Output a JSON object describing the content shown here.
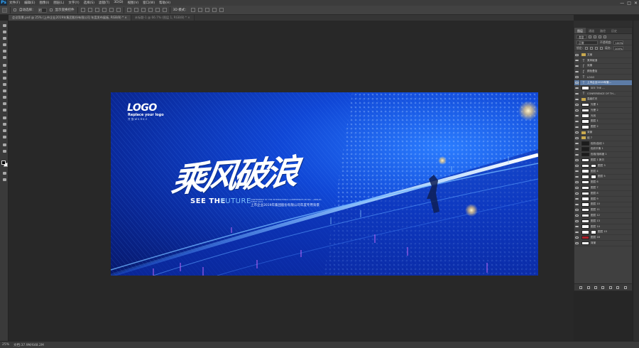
{
  "app": {
    "logo": "Ps",
    "window_controls": [
      "—",
      "□",
      "✕"
    ]
  },
  "menu": [
    "文件(F)",
    "编辑(E)",
    "图像(I)",
    "图层(L)",
    "文字(Y)",
    "选择(S)",
    "滤镜(T)",
    "3D(D)",
    "视图(V)",
    "窗口(W)",
    "帮助(H)"
  ],
  "options": {
    "auto_select_label": "自动选择：",
    "auto_select_value": "组",
    "show_transform_label": "显示变换控件",
    "mode_3d_label": "3D 模式："
  },
  "tabs": [
    {
      "label": "会议背景.psd @ 25% (上市企业2019年集团股份有限公司 年度发布展板, RGB/8) * ×"
    },
    {
      "label": "未标题-1 @ 66.7% (图层 1, RGB/8) * ×"
    }
  ],
  "artwork": {
    "logo": "LOGO",
    "logo_sub": "Replace your logo",
    "logo_sub2": "开 放  W S R K 2",
    "headline": "乘风破浪",
    "see": "SEE THE",
    "future": "FUTURE",
    "conference_en": "CONFERENCE OF THE INTERNATIONAL CONFERENCE ON HIG... ANNUAL EVENT 2019",
    "conference_cn": "上市企业2019年集团股份有限公司年度专用背景"
  },
  "status": {
    "zoom": "25%",
    "doc": "文档:37.9M/648.2M"
  },
  "panel": {
    "tabs": [
      "图层",
      "通道",
      "路径",
      "历史"
    ],
    "filter_label": "类型",
    "blend_mode": "正常",
    "opacity_label": "不透明度:",
    "opacity_value": "100%",
    "lock_label": "锁定:",
    "fill_label": "填充:",
    "fill_value": "100%"
  },
  "layers": [
    {
      "name": "文案",
      "kind": "folder"
    },
    {
      "name": "乘风破浪",
      "kind": "text"
    },
    {
      "name": "效果",
      "kind": "fx"
    },
    {
      "name": "颜色叠加",
      "kind": "fx"
    },
    {
      "name": "LOGO",
      "kind": "text"
    },
    {
      "name": "上市企业2019年集...",
      "kind": "text",
      "selected": true
    },
    {
      "name": "SEE THE ...",
      "kind": "pixel"
    },
    {
      "name": "CONFERENCE OF TH...",
      "kind": "text"
    },
    {
      "name": "高级灯光",
      "kind": "folder"
    },
    {
      "name": "光晕 1",
      "kind": "pixel"
    },
    {
      "name": "光晕 2",
      "kind": "pixel"
    },
    {
      "name": "光效",
      "kind": "pixel"
    },
    {
      "name": "图层 1",
      "kind": "pixel"
    },
    {
      "name": "图层 2",
      "kind": "pixel"
    },
    {
      "name": "背景",
      "kind": "folder"
    },
    {
      "name": "组 7",
      "kind": "folder"
    },
    {
      "name": "色阶/曲线 1",
      "kind": "adjust"
    },
    {
      "name": "色彩平衡 1",
      "kind": "adjust"
    },
    {
      "name": "色相/饱和度 1",
      "kind": "adjust"
    },
    {
      "name": "图层 1 拷贝",
      "kind": "pixel"
    },
    {
      "name": "图层 3",
      "kind": "mask"
    },
    {
      "name": "图层 4",
      "kind": "pixel"
    },
    {
      "name": "图层 5",
      "kind": "mask"
    },
    {
      "name": "图层 6",
      "kind": "pixel"
    },
    {
      "name": "图层 7",
      "kind": "pixel"
    },
    {
      "name": "图层 8",
      "kind": "pixel"
    },
    {
      "name": "图层 9",
      "kind": "pixel"
    },
    {
      "name": "图层 10",
      "kind": "pixel"
    },
    {
      "name": "图层 11",
      "kind": "pixel"
    },
    {
      "name": "图层 12",
      "kind": "pixel"
    },
    {
      "name": "图层 13",
      "kind": "pixel"
    },
    {
      "name": "图层 14",
      "kind": "pixel"
    },
    {
      "name": "图层 15",
      "kind": "mask"
    },
    {
      "name": "图层 16",
      "kind": "red"
    },
    {
      "name": "背景",
      "kind": "pixel"
    }
  ],
  "colors": {
    "accent": "#5d7ca6",
    "artboard": "#1047d6",
    "highlight": "#31a8ff"
  }
}
